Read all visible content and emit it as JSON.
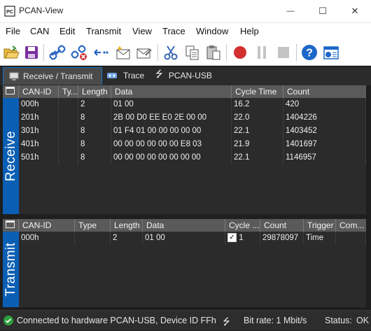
{
  "window": {
    "title": "PCAN-View",
    "minimize": "—",
    "maximize": "☐",
    "close": "✕"
  },
  "menu": [
    "File",
    "CAN",
    "Edit",
    "Transmit",
    "View",
    "Trace",
    "Window",
    "Help"
  ],
  "toolbar_icons": [
    "open-icon",
    "save-icon",
    "connect-icon",
    "disconnect-icon",
    "reset-icon",
    "new-message-icon",
    "edit-message-icon",
    "cut-icon",
    "copy-icon",
    "paste-icon",
    "record-icon",
    "pause-icon",
    "stop-icon",
    "help-icon",
    "about-icon"
  ],
  "tabs": [
    {
      "label": "Receive / Transmit"
    },
    {
      "label": "Trace"
    },
    {
      "label": "PCAN-USB"
    }
  ],
  "receive": {
    "side_label": "Receive",
    "columns": [
      "CAN-ID",
      "Ty...",
      "Length",
      "Data",
      "Cycle Time",
      "Count"
    ],
    "rows": [
      {
        "id": "000h",
        "type": "",
        "length": "2",
        "data": "01 00",
        "cycle": "16.2",
        "count": "420"
      },
      {
        "id": "201h",
        "type": "",
        "length": "8",
        "data": "2B 00 D0 EE E0 2E 00 00",
        "cycle": "22.0",
        "count": "1404226"
      },
      {
        "id": "301h",
        "type": "",
        "length": "8",
        "data": "01 F4 01 00 00 00 00 00",
        "cycle": "22.1",
        "count": "1403452"
      },
      {
        "id": "401h",
        "type": "",
        "length": "8",
        "data": "00 00 00 00 00 00 E8 03",
        "cycle": "21.9",
        "count": "1401697"
      },
      {
        "id": "501h",
        "type": "",
        "length": "8",
        "data": "00 00 00 00 00 00 00 00",
        "cycle": "22.1",
        "count": "1146957"
      }
    ]
  },
  "transmit": {
    "side_label": "Transmit",
    "columns": [
      "CAN-ID",
      "Type",
      "Length",
      "Data",
      "Cycle ...",
      "Count",
      "Trigger",
      "Com..."
    ],
    "rows": [
      {
        "id": "000h",
        "type": "",
        "length": "2",
        "data": "01 00",
        "cycle_checked": true,
        "cycle": "1",
        "count": "29878097",
        "trigger": "Time",
        "comment": ""
      }
    ]
  },
  "status": {
    "connection": "Connected to hardware PCAN-USB, Device ID FFh",
    "bitrate": "Bit rate: 1 Mbit/s",
    "status_label": "Status:",
    "status_value": "OK"
  },
  "colors": {
    "accent": "#0a5fb4",
    "ok_green": "#2e9e3e",
    "record_red": "#d32f2f"
  }
}
